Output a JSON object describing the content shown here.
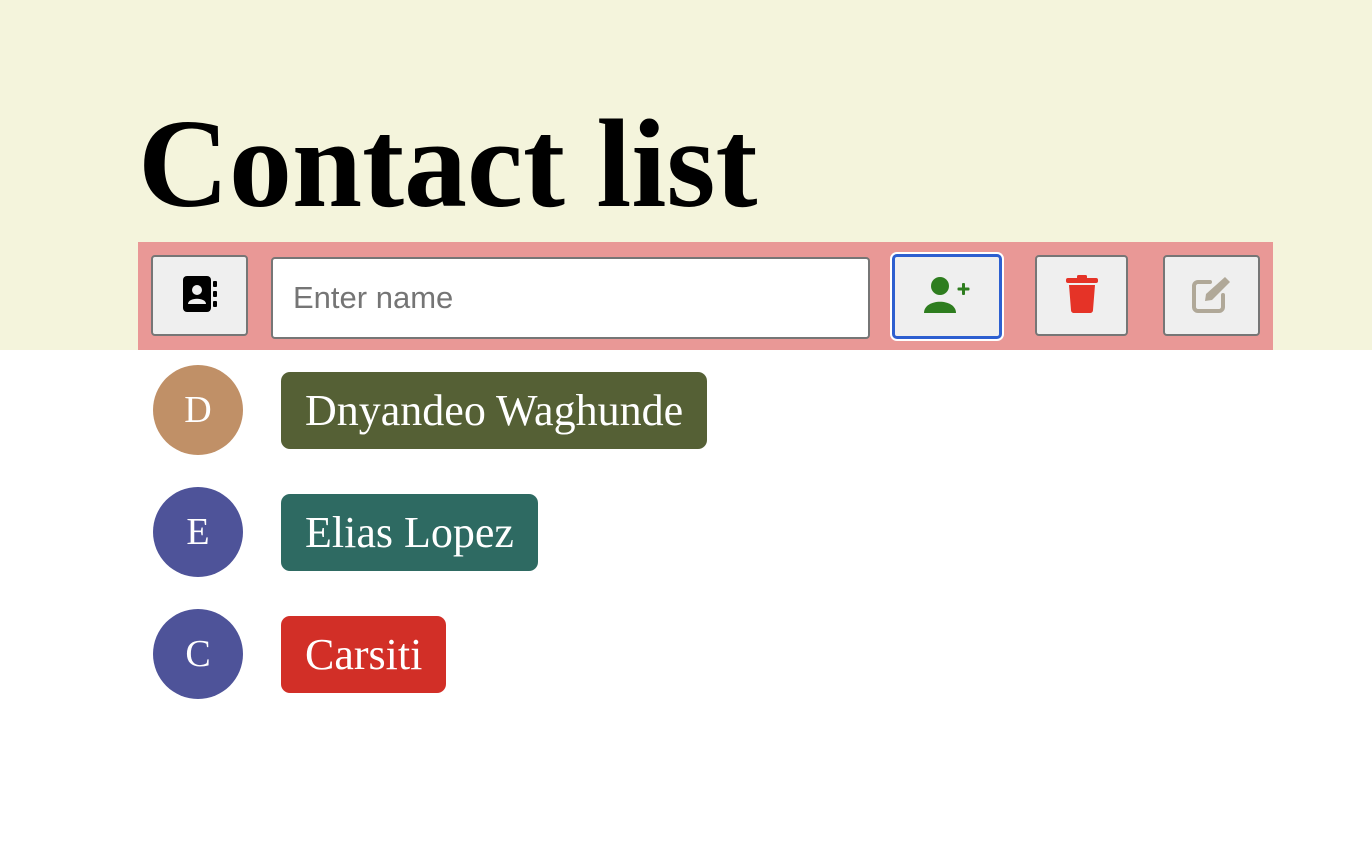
{
  "page": {
    "title": "Contact list",
    "header_background": "#f4f4dc",
    "toolbar_background": "#e99896"
  },
  "toolbar": {
    "contacts_button": {
      "icon": "address-book-icon",
      "color": "#000000"
    },
    "name_input": {
      "value": "",
      "placeholder": "Enter name"
    },
    "add_button": {
      "icon": "user-plus-icon",
      "color": "#2e7d1f",
      "focused": true
    },
    "delete_button": {
      "icon": "trash-icon",
      "color": "#e53327"
    },
    "edit_button": {
      "icon": "edit-icon",
      "color": "#b0a898"
    }
  },
  "contacts": [
    {
      "initial": "D",
      "name": "Dnyandeo Waghunde",
      "avatar_color": "#c09067",
      "chip_color": "#556035"
    },
    {
      "initial": "E",
      "name": "Elias Lopez",
      "avatar_color": "#4e5399",
      "chip_color": "#2e6a62"
    },
    {
      "initial": "C",
      "name": "Carsiti",
      "avatar_color": "#4e5399",
      "chip_color": "#d22f27"
    }
  ]
}
